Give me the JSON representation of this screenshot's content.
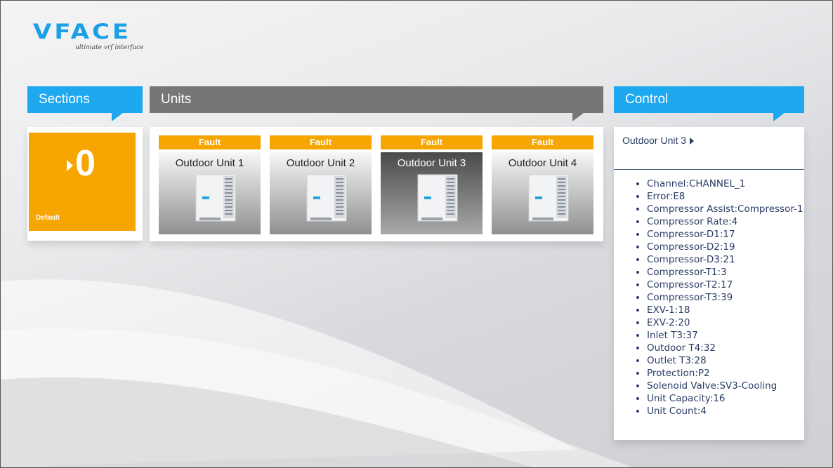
{
  "logo": {
    "word": "VFACE",
    "tagline": "ultimate vrf interface"
  },
  "sections": {
    "header": "Sections",
    "tile": {
      "count": "0",
      "name": "Default"
    }
  },
  "units": {
    "header": "Units",
    "items": [
      {
        "badge": "Fault",
        "name": "Outdoor Unit 1"
      },
      {
        "badge": "Fault",
        "name": "Outdoor Unit 2"
      },
      {
        "badge": "Fault",
        "name": "Outdoor Unit 3"
      },
      {
        "badge": "Fault",
        "name": "Outdoor Unit 4"
      }
    ]
  },
  "control": {
    "header": "Control",
    "selected_unit": "Outdoor Unit 3",
    "properties": [
      "Channel:CHANNEL_1",
      "Error:E8",
      "Compressor Assist:Compressor-1",
      "Compressor Rate:4",
      "Compressor-D1:17",
      "Compressor-D2:19",
      "Compressor-D3:21",
      "Compressor-T1:3",
      "Compressor-T2:17",
      "Compressor-T3:39",
      "EXV-1:18",
      "EXV-2:20",
      "Inlet T3:37",
      "Outdoor T4:32",
      "Outlet T3:28",
      "Protection:P2",
      "Solenoid Valve:SV3-Cooling",
      "Unit Capacity:16",
      "Unit Count:4"
    ]
  },
  "colors": {
    "accent_blue": "#1ea8ef",
    "fault_orange": "#f7a500",
    "units_gray": "#767676"
  }
}
